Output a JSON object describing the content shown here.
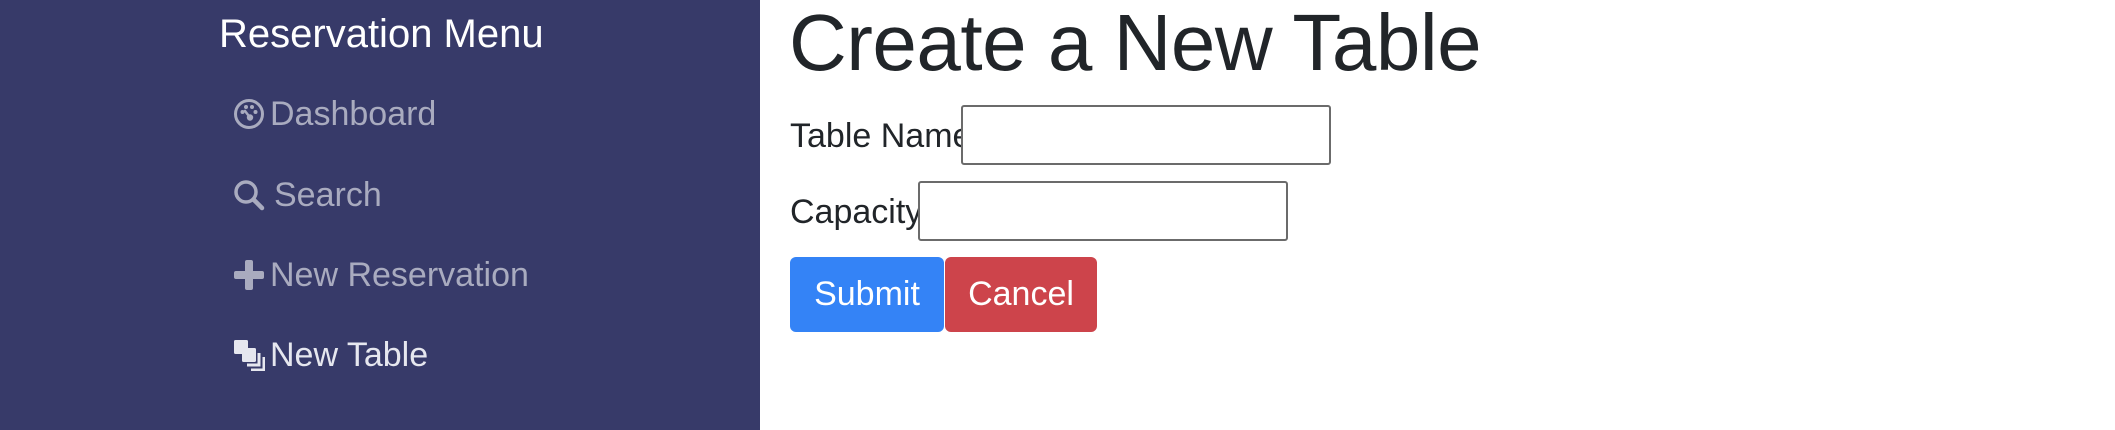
{
  "sidebar": {
    "title": "Reservation Menu",
    "items": [
      {
        "label": "Dashboard",
        "icon": "dashboard-icon",
        "active": false
      },
      {
        "label": "Search",
        "icon": "search-icon",
        "active": false
      },
      {
        "label": "New Reservation",
        "icon": "plus-icon",
        "active": false
      },
      {
        "label": "New Table",
        "icon": "layers-icon",
        "active": true
      }
    ]
  },
  "main": {
    "title": "Create a New Table",
    "form": {
      "table_name": {
        "label": "Table Name",
        "value": "",
        "placeholder": ""
      },
      "capacity": {
        "label": "Capacity",
        "value": "",
        "placeholder": ""
      },
      "submit_label": "Submit",
      "cancel_label": "Cancel"
    }
  },
  "colors": {
    "sidebar_bg": "#373a69",
    "nav_text": "#a9abbf",
    "nav_text_active": "#e6e7ef",
    "primary": "#3483f6",
    "danger": "#cd444b",
    "text": "#212529"
  }
}
